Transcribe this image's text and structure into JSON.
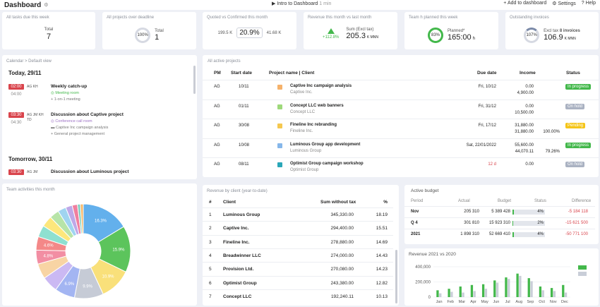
{
  "header": {
    "title": "Dashboard",
    "intro_label": "Intro to Dashboard",
    "intro_duration": "1 min",
    "add_label": "+ Add to dashboard",
    "settings_label": "Settings",
    "help_label": "Help"
  },
  "kpis": {
    "tasks": {
      "label": "All tasks due this week",
      "sub": "Total",
      "value": "7"
    },
    "projects": {
      "label": "All projects over deadline",
      "ring": "100%",
      "sub": "Total",
      "value": "1"
    },
    "quoted": {
      "label": "Quoted vs Confirmed this month",
      "left": "199.5 K",
      "pct": "20.9%",
      "right": "41.68 K"
    },
    "revenue": {
      "label": "Revenue this month vs last month",
      "change": "+112.8%",
      "sub": "Sum (Excl tax)",
      "value": "205.3",
      "unit": "K MNN"
    },
    "team": {
      "label": "Team h planned this week",
      "ring": "83%",
      "sub": "Planned*",
      "value": "165:00",
      "unit": "h"
    },
    "invoices": {
      "label": "Outstanding invoices",
      "ring": "107%",
      "sub_prefix": "Excl tax",
      "sub_bold": "8 invoices",
      "value": "106.9",
      "unit": "K MNN"
    }
  },
  "calendar": {
    "label": "Calendar > Default view",
    "today": "Today, 29/11",
    "tomorrow": "Tomorrow, 30/11",
    "events": [
      {
        "start": "02:00",
        "end": "04:00",
        "initials": "AG KH",
        "title": "Weekly catch-up",
        "location": "Meeting room",
        "lines": [
          "+ 1-on-1 meeting"
        ]
      },
      {
        "start": "03:30",
        "end": "04:30",
        "initials": "AG JM KH TD",
        "title": "Discussion about Captive project",
        "location": "Conference call room",
        "lines": [
          "Captive Inc campaign analysis",
          "+ General project management"
        ]
      },
      {
        "start": "03:30",
        "end": "",
        "initials": "AG JM",
        "title": "Discussion about Luminous project",
        "location": "",
        "lines": []
      }
    ]
  },
  "projects": {
    "label": "All active projects",
    "headers": {
      "pm": "PM",
      "start": "Start date",
      "name": "Project name | Client",
      "due": "Due date",
      "income": "Income",
      "status": "Status"
    },
    "rows": [
      {
        "pm": "AG",
        "start": "10/11",
        "color": "#f5b26b",
        "name": "Captive Inc campaign analysis",
        "client": "Captive Inc.",
        "due": "Fri, 10/12",
        "income1": "0.00",
        "income2": "4,900.00",
        "pct": "",
        "status": "In progress",
        "status_color": "#43b84b",
        "overdue": false
      },
      {
        "pm": "AG",
        "start": "01/11",
        "color": "#9ed97b",
        "name": "Concept LLC web banners",
        "client": "Concept LLC",
        "due": "Fri, 31/12",
        "income1": "0.00",
        "income2": "10,500.00",
        "pct": "",
        "status": "On hold",
        "status_color": "#aab2c2",
        "overdue": false
      },
      {
        "pm": "AG",
        "start": "30/08",
        "color": "#f5c84f",
        "name": "Fineline Inc rebranding",
        "client": "Fineline Inc.",
        "due": "Fri, 17/12",
        "income1": "31,880.00",
        "income2": "31,880.00",
        "pct": "100.00%",
        "status": "Pending",
        "status_color": "#f5c518",
        "overdue": false
      },
      {
        "pm": "AG",
        "start": "10/08",
        "color": "#86b7ea",
        "name": "Luminous Group app development",
        "client": "Luminous Group",
        "due": "Sat, 22/01/2022",
        "income1": "55,600.00",
        "income2": "44,070.11",
        "pct": "79.26%",
        "status": "In progress",
        "status_color": "#43b84b",
        "overdue": false
      },
      {
        "pm": "AG",
        "start": "08/11",
        "color": "#2aa7b8",
        "name": "Optimist Group campaign workshop",
        "client": "Optimist Group",
        "due": "12 d",
        "income1": "0.00",
        "income2": "",
        "pct": "",
        "status": "On hold",
        "status_color": "#aab2c2",
        "overdue": true
      }
    ]
  },
  "team_activities": {
    "label": "Team activities this month",
    "chart_data": {
      "type": "pie",
      "title": "",
      "slices": [
        {
          "value": 16.3,
          "color": "#63b0ec"
        },
        {
          "value": 15.9,
          "color": "#5cc45c"
        },
        {
          "value": 10.9,
          "color": "#f9e07a"
        },
        {
          "value": 9.9,
          "color": "#c6cbd6"
        },
        {
          "value": 6.9,
          "color": "#a3b5f2"
        },
        {
          "value": 5.5,
          "color": "#cbb9f3"
        },
        {
          "value": 5.2,
          "color": "#f8d4a4"
        },
        {
          "value": 4.8,
          "color": "#f28ea3"
        },
        {
          "value": 4.6,
          "color": "#f48888"
        },
        {
          "value": 4.0,
          "color": "#8ee0d0"
        },
        {
          "value": 3.8,
          "color": "#fde77c"
        },
        {
          "value": 3.3,
          "color": "#b7e4a8"
        },
        {
          "value": 2.8,
          "color": "#a0d4f0"
        },
        {
          "value": 2.3,
          "color": "#bfa8e8"
        },
        {
          "value": 1.8,
          "color": "#f07f9f"
        },
        {
          "value": 1.0,
          "color": "#80d0c0"
        },
        {
          "value": 1.0,
          "color": "#f7b96a"
        }
      ],
      "labels": [
        "16.3%",
        "15.9%",
        "10.9%",
        "9.9%",
        "6.9%",
        "",
        "",
        "4.8%",
        "4.6%",
        "",
        "",
        "",
        "",
        "",
        "",
        "",
        ""
      ]
    }
  },
  "revenue_client": {
    "label": "Revenue by client (year-to-date)",
    "headers": {
      "num": "#",
      "client": "Client",
      "sum": "Sum without tax",
      "pct": "%"
    },
    "rows": [
      {
        "num": "1",
        "client": "Luminous Group",
        "sum": "345,330.00",
        "pct": "18.19"
      },
      {
        "num": "2",
        "client": "Captive Inc.",
        "sum": "294,400.00",
        "pct": "15.51"
      },
      {
        "num": "3",
        "client": "Fineline Inc.",
        "sum": "278,880.00",
        "pct": "14.69"
      },
      {
        "num": "4",
        "client": "Breadwinner LLC",
        "sum": "274,000.00",
        "pct": "14.43"
      },
      {
        "num": "5",
        "client": "Provision Ltd.",
        "sum": "270,080.00",
        "pct": "14.23"
      },
      {
        "num": "6",
        "client": "Optimist Group",
        "sum": "243,380.00",
        "pct": "12.82"
      },
      {
        "num": "7",
        "client": "Concept LLC",
        "sum": "192,240.11",
        "pct": "10.13"
      }
    ]
  },
  "budget": {
    "label": "Active budget",
    "headers": {
      "period": "Period",
      "actual": "Actual",
      "budget": "Budget",
      "status": "Status",
      "difference": "Difference"
    },
    "rows": [
      {
        "period": "Nov",
        "actual": "205 310",
        "budget": "5 389 428",
        "status": "4%",
        "fill": 0.04,
        "difference": "-5 184 118"
      },
      {
        "period": "Q 4",
        "actual": "301 810",
        "budget": "15 923 310",
        "status": "2%",
        "fill": 0.02,
        "difference": "-15 621 500"
      },
      {
        "period": "2021",
        "actual": "1 898 310",
        "budget": "52 669 410",
        "status": "4%",
        "fill": 0.04,
        "difference": "-50 771 100"
      }
    ]
  },
  "revenue_chart": {
    "label": "Revenue 2021 vs 2020",
    "chart_data": {
      "type": "bar",
      "title": "",
      "categories": [
        "Jan",
        "Feb",
        "Mar",
        "Apr",
        "May",
        "Jun",
        "Jul",
        "Aug",
        "Sep",
        "Oct",
        "Nov",
        "Dec"
      ],
      "ylim": [
        0,
        400000
      ],
      "yticks": [
        "400,000",
        "200,000",
        "0"
      ],
      "series": [
        {
          "color": "#43b84b",
          "values": [
            90000,
            110000,
            140000,
            160000,
            170000,
            220000,
            260000,
            310000,
            250000,
            140000,
            120000,
            160000
          ]
        },
        {
          "color": "#c9ced8",
          "values": [
            50000,
            70000,
            60000,
            80000,
            110000,
            190000,
            240000,
            280000,
            210000,
            90000,
            80000,
            60000
          ]
        }
      ]
    }
  }
}
